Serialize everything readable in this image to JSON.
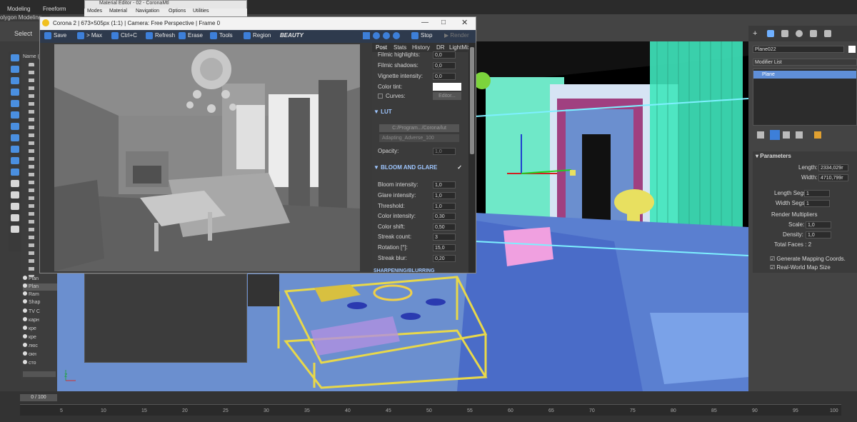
{
  "ribbon": {
    "tab1": "Modeling",
    "tab2": "Freeform",
    "sub": "olygon Modeling",
    "select": "Select"
  },
  "material_editor": {
    "title": "Material Editor - 02 - CoronaMtl",
    "menu": [
      "Modes",
      "Material",
      "Navigation",
      "Options",
      "Utilities"
    ]
  },
  "scene": {
    "header": "Name (S",
    "items": [
      "Plan",
      "Plan",
      "Ram",
      "Shap",
      "TV C",
      "карн",
      "кре",
      "кре",
      "люс",
      "окн",
      "сто"
    ]
  },
  "corona": {
    "title": "Corona 2 | 673×505px (1:1) | Camera: Free Perspective | Frame 0",
    "toolbar": {
      "save": "Save",
      "max": "> Max",
      "copy": "Ctrl+C",
      "refresh": "Refresh",
      "erase": "Erase",
      "tools": "Tools",
      "region": "Region",
      "beauty": "BEAUTY",
      "stop": "Stop",
      "render": "Render"
    },
    "tabs": [
      "Post",
      "Stats",
      "History",
      "DR",
      "LightMix"
    ],
    "tone": [
      {
        "label": "Filmic highlights:",
        "value": "0,0"
      },
      {
        "label": "Filmic shadows:",
        "value": "0,0"
      },
      {
        "label": "Vignette intensity:",
        "value": "0,0"
      }
    ],
    "color_tint": "Color tint:",
    "curves": "Curves:",
    "editor": "Editor...",
    "lut_title": "LUT",
    "lut_path": "C:/Program.../Corona/lut",
    "lut_file": "Adapting_Adverse_100",
    "opacity_label": "Opacity:",
    "opacity_value": "1,0",
    "bloom_title": "BLOOM AND GLARE",
    "bloom": [
      {
        "label": "Bloom intensity:",
        "value": "1,0"
      },
      {
        "label": "Glare intensity:",
        "value": "1,0"
      },
      {
        "label": "Threshold:",
        "value": "1,0"
      },
      {
        "label": "Color intensity:",
        "value": "0,30"
      },
      {
        "label": "Color shift:",
        "value": "0,50"
      },
      {
        "label": "Streak count:",
        "value": "3"
      },
      {
        "label": "Rotation [°]:",
        "value": "15,0"
      },
      {
        "label": "Streak blur:",
        "value": "0,20"
      }
    ],
    "sharpen_title": "SHARPENING/BLURRING"
  },
  "command_panel": {
    "object_name": "Plane022",
    "modifier_list": "Modifier List",
    "stack_item": "Plane",
    "params_title": "Parameters",
    "length_label": "Length:",
    "length_value": "2334,029r",
    "width_label": "Width:",
    "width_value": "4710,799r",
    "lsegs_label": "Length Segs:",
    "lsegs_value": "1",
    "wsegs_label": "Width Segs:",
    "wsegs_value": "1",
    "render_mult": "Render Multipliers",
    "scale_label": "Scale:",
    "scale_value": "1,0",
    "density_label": "Density:",
    "density_value": "1,0",
    "total_faces": "Total Faces : 2",
    "gen_map": "Generate Mapping Coords.",
    "real_world": "Real-World Map Size"
  },
  "timeline": {
    "slider": "0 / 100",
    "ticks": [
      "5",
      "10",
      "15",
      "20",
      "25",
      "30",
      "35",
      "40",
      "45",
      "50",
      "55",
      "60",
      "65",
      "70",
      "75",
      "80",
      "85",
      "90",
      "95",
      "100"
    ]
  },
  "colors": {
    "accent": "#3d7fd9",
    "viewport": "#6b8fcf",
    "curtain": "#4ff0c0",
    "yellow": "#e8d84a",
    "pink": "#e896d8"
  }
}
